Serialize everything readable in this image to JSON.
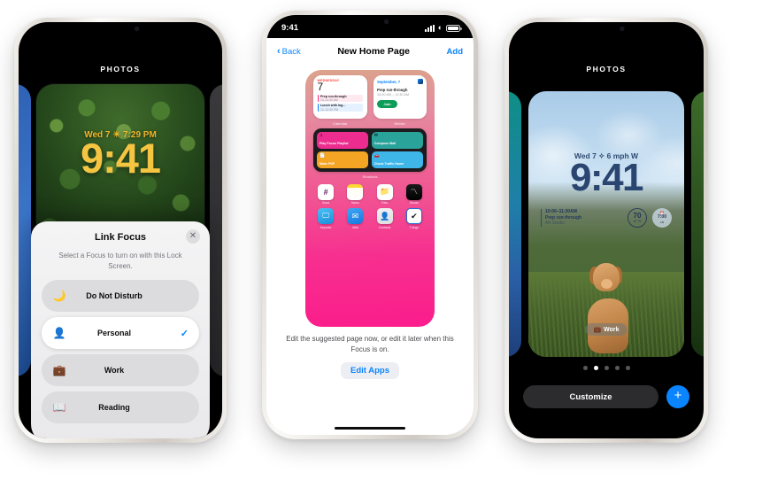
{
  "phone_left": {
    "gallery_label": "PHOTOS",
    "lock_screen": {
      "date": "Wed 7  ☀  7:29 PM",
      "time": "9:41"
    },
    "sheet": {
      "title": "Link Focus",
      "close_icon": "✕",
      "subtitle": "Select a Focus to turn on with this Lock Screen.",
      "options": [
        {
          "icon": "🌙",
          "label": "Do Not Disturb",
          "selected": false,
          "check": ""
        },
        {
          "icon": "👤",
          "label": "Personal",
          "selected": true,
          "check": "✓"
        },
        {
          "icon": "💼",
          "label": "Work",
          "selected": false,
          "check": ""
        },
        {
          "icon": "📖",
          "label": "Reading",
          "selected": false,
          "check": ""
        }
      ]
    }
  },
  "phone_center": {
    "status_bar": {
      "time": "9:41"
    },
    "nav": {
      "back_label": "Back",
      "back_chevron": "‹",
      "title": "New Home Page",
      "add_label": "Add"
    },
    "home_preview": {
      "calendar_widget": {
        "day_of_week": "WEDNESDAY",
        "day_number": "7",
        "events": [
          {
            "title": "Prep run-through",
            "sub": "10–11:30 AM"
          },
          {
            "title": "Lunch with Ing...",
            "sub": "12–12:30 PM"
          }
        ],
        "label": "Calendar"
      },
      "webex_widget": {
        "title": "September, 7",
        "event": "Prep run-through",
        "time": "10:00 AM – 11:30 AM",
        "join_label": "Join",
        "label": "Webex"
      },
      "shortcuts_widget": {
        "tiles": [
          {
            "glyph": "♫",
            "name": "Play Focus Playlist"
          },
          {
            "glyph": "✉",
            "name": "Compose Mail"
          },
          {
            "glyph": "📄",
            "name": "Make PDF"
          },
          {
            "glyph": "🚗",
            "name": "Check Traffic Home"
          }
        ],
        "label": "Shortcuts"
      },
      "apps": [
        {
          "name": "Slack",
          "glyph": "#"
        },
        {
          "name": "Notes",
          "glyph": ""
        },
        {
          "name": "Files",
          "glyph": "📁"
        },
        {
          "name": "Stocks",
          "glyph": "📈"
        },
        {
          "name": "Keynote",
          "glyph": "🖥"
        },
        {
          "name": "Mail",
          "glyph": "✉"
        },
        {
          "name": "Contacts",
          "glyph": "👤"
        },
        {
          "name": "Things",
          "glyph": "✔"
        }
      ]
    },
    "footer": {
      "note": "Edit the suggested page now, or edit it later when this Focus is on.",
      "edit_apps_label": "Edit Apps"
    }
  },
  "phone_right": {
    "gallery_label": "PHOTOS",
    "lock_screen": {
      "date": "Wed 7  ✧ 6 mph W",
      "time": "9:41",
      "widgets": {
        "calendar": {
          "line1": "10:00–11:30AM",
          "line2": "Prep run-through",
          "line3": "Art Studio"
        },
        "temperature": {
          "current": "70",
          "range": "57  75"
        },
        "alarm": {
          "glyph": "⏰",
          "time": "7:00",
          "meridiem": "AM"
        }
      },
      "focus_badge": {
        "icon": "💼",
        "label": "Work"
      }
    },
    "page_dots": {
      "count": 5,
      "active_index": 1
    },
    "bottom_bar": {
      "customize_label": "Customize",
      "add_icon": "+"
    }
  },
  "colors": {
    "accent_blue": "#0a84ff",
    "lock_time_yellow": "#f5c542",
    "lock_time_blue": "#2a4570",
    "join_green": "#0e9d58"
  }
}
